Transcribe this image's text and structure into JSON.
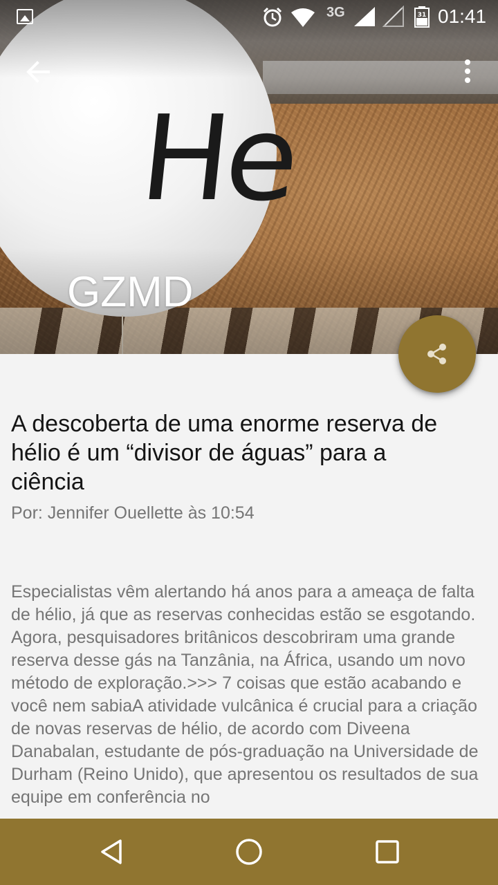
{
  "status_bar": {
    "time": "01:41",
    "network_type": "3G",
    "icons": [
      "gallery-icon",
      "alarm-icon",
      "wifi-icon",
      "signal-icon",
      "signal-empty-icon",
      "battery-icon"
    ],
    "battery_level_label": "31"
  },
  "app_bar": {
    "back_icon": "arrow-left-icon",
    "menu_icon": "more-vert-icon"
  },
  "hero": {
    "brand_title": "GZMD",
    "balloon_text": "He"
  },
  "fab": {
    "icon": "share-icon",
    "color": "#907530"
  },
  "article": {
    "title": "A descoberta de uma enorme reserva de hélio é um “divisor de águas” para a ciência",
    "byline": "Por: Jennifer Ouellette às 10:54",
    "body": "Especialistas vêm alertando há anos para a ameaça de falta de hélio, já que as reservas conhecidas estão se esgotando. Agora, pesquisadores britânicos descobriram uma grande reserva desse gás na Tanzânia, na África, usando um novo método de exploração.>>> 7 coisas que estão acabando e você nem sabiaA atividade vulcânica é crucial para a criação de novas reservas de hélio, de acordo com Diveena Danabalan, estudante de pós-graduação na Universidade de Durham (Reino Unido), que apresentou os resultados de sua equipe em conferência no"
  },
  "nav_bar": {
    "color": "#907530",
    "icons": [
      "nav-back-icon",
      "nav-home-icon",
      "nav-recents-icon"
    ]
  }
}
